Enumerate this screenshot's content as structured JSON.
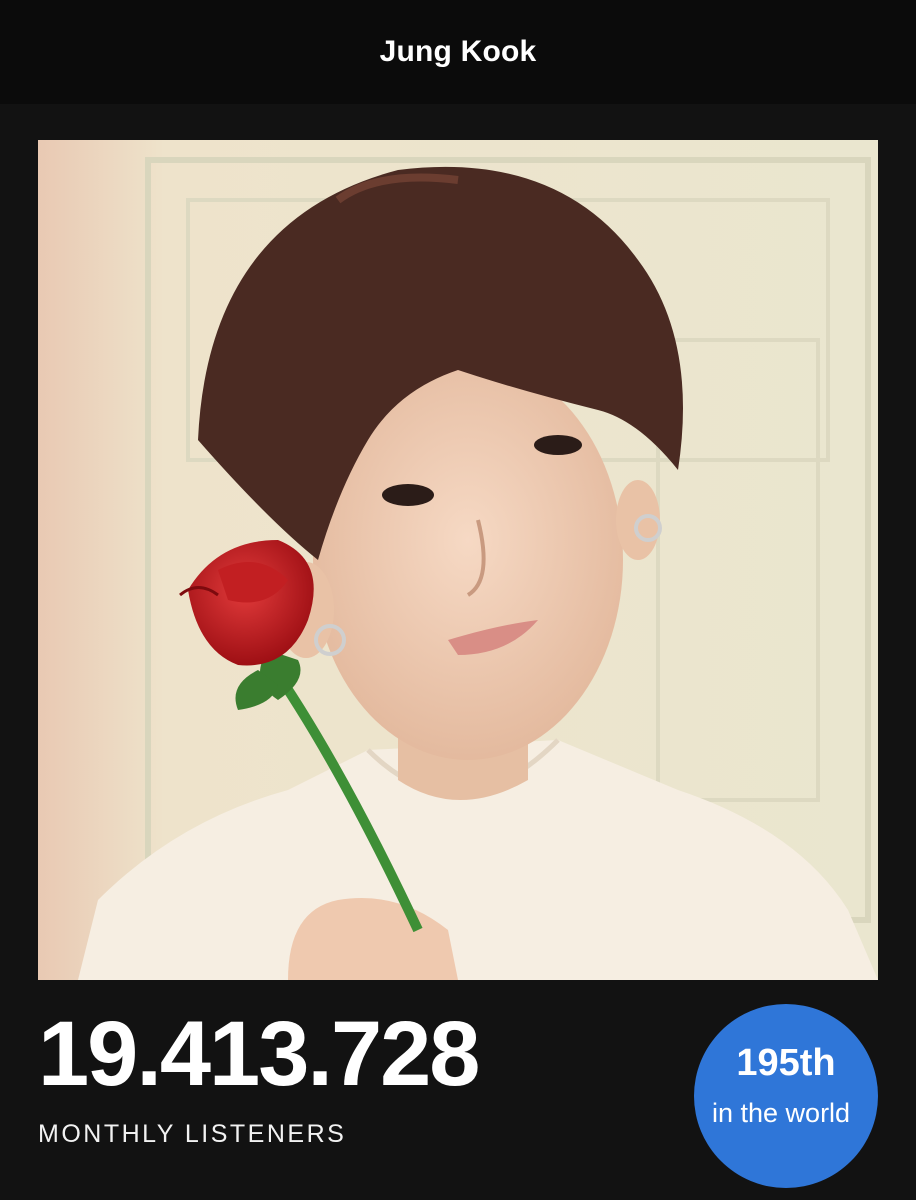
{
  "header": {
    "artist_name": "Jung Kook"
  },
  "stats": {
    "monthly_listeners": "19.413.728",
    "monthly_listeners_label": "MONTHLY LISTENERS"
  },
  "rank": {
    "position": "195th",
    "subtitle": "in the world"
  },
  "colors": {
    "background": "#121212",
    "rank_badge": "#2f76d8"
  }
}
